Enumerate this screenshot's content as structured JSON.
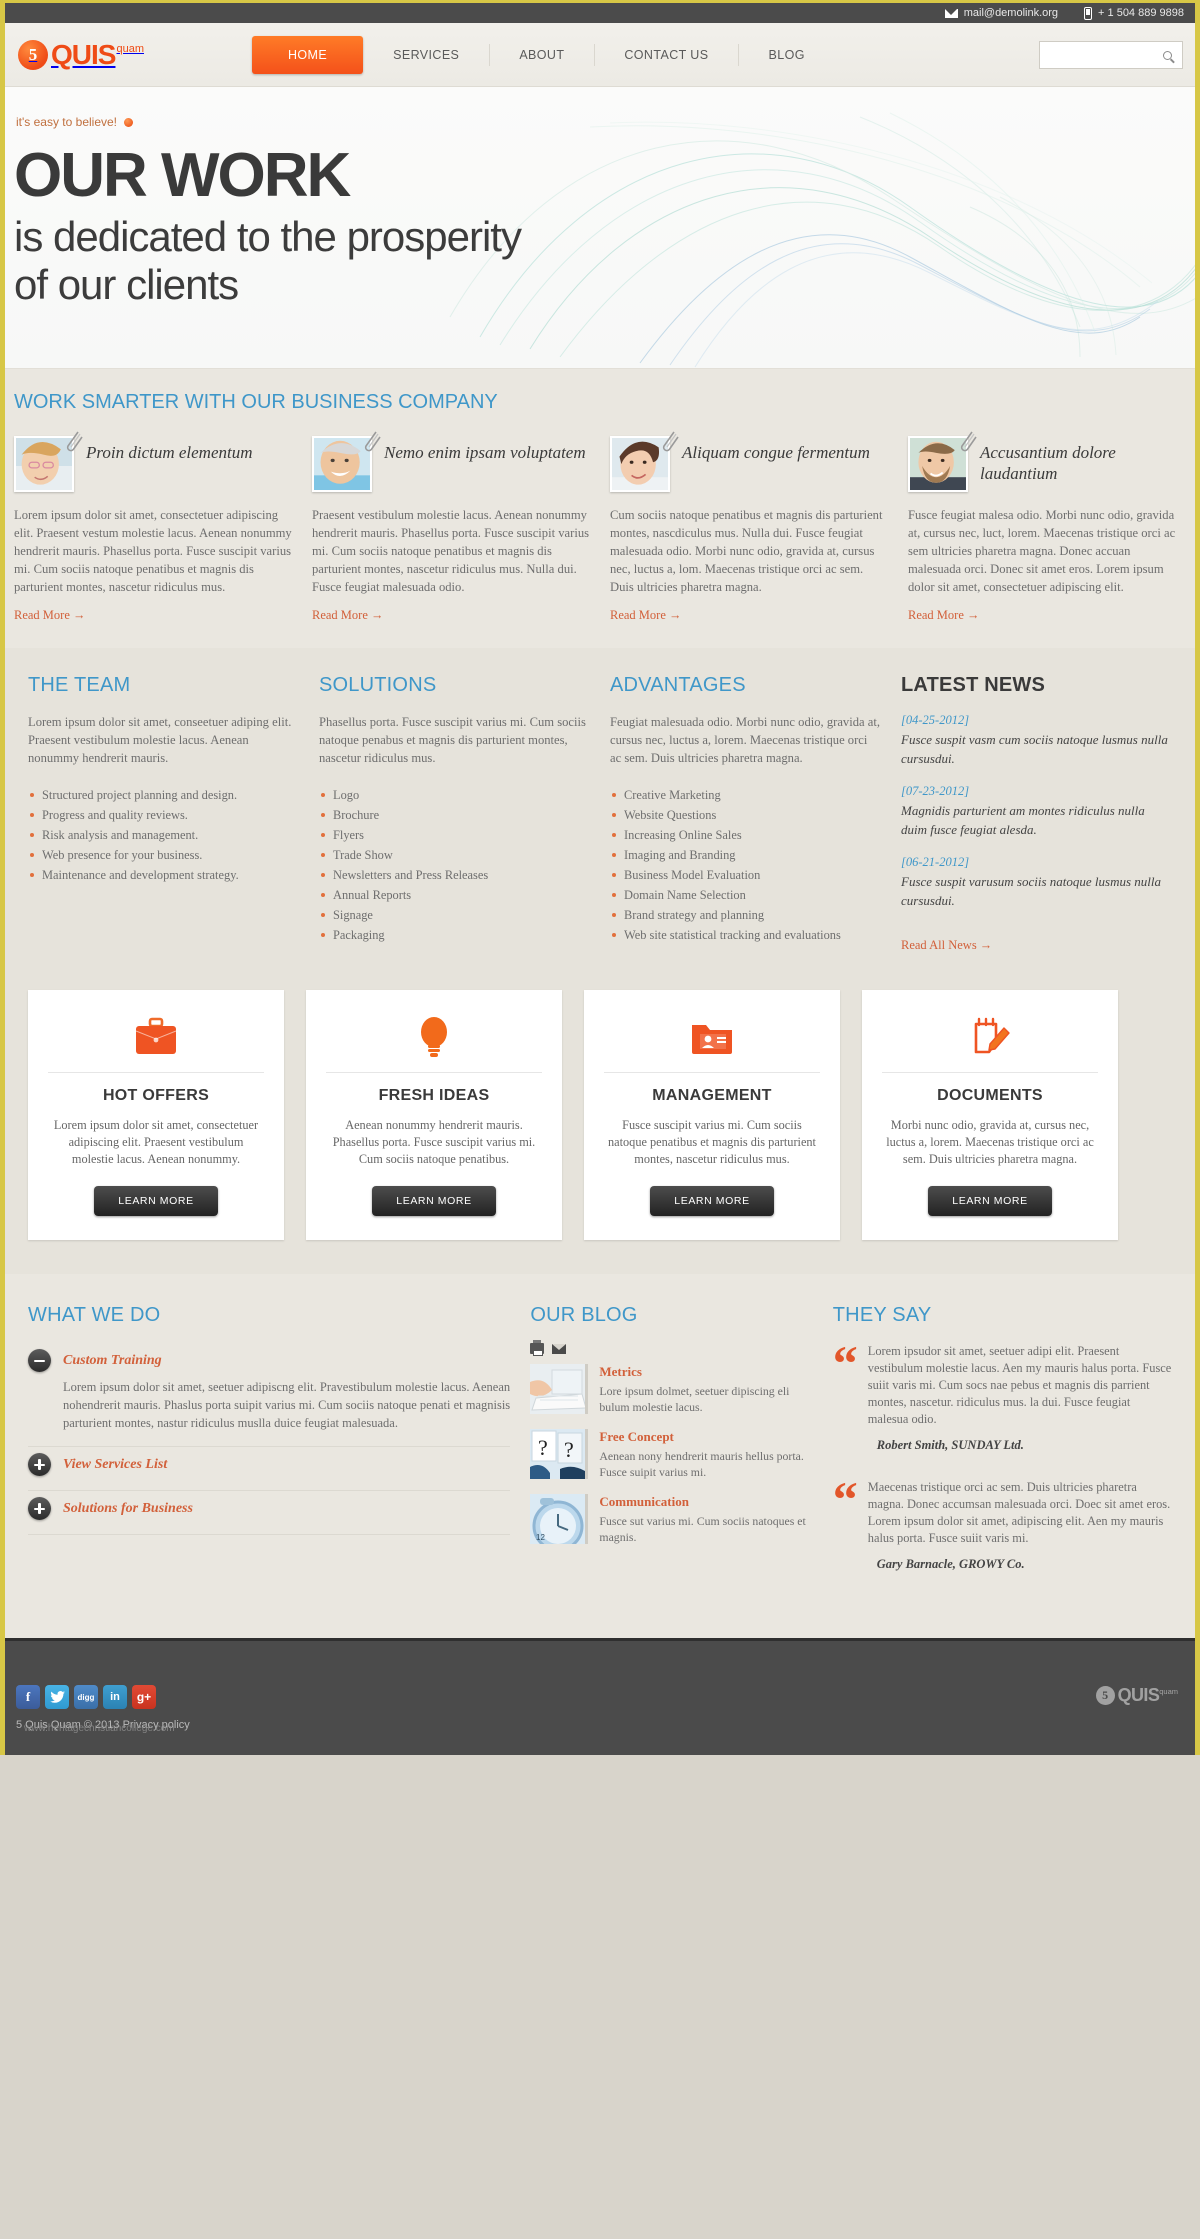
{
  "topbar": {
    "email": "mail@demolink.org",
    "phone": "+ 1 504 889 9898"
  },
  "header": {
    "logo": {
      "mark": "5",
      "name": "QUIS",
      "sup": "quam"
    },
    "nav": [
      {
        "label": "HOME",
        "active": true
      },
      {
        "label": "SERVICES",
        "active": false
      },
      {
        "label": "ABOUT",
        "active": false
      },
      {
        "label": "CONTACT US",
        "active": false
      },
      {
        "label": "BLOG",
        "active": false
      }
    ],
    "search": {
      "value": "",
      "placeholder": ""
    }
  },
  "hero": {
    "tagline": "it's easy to believe!",
    "title": "OUR WORK",
    "subtitle_line1": "is dedicated to the prosperity",
    "subtitle_line2": "of our clients",
    "prev": "‹",
    "next": "›"
  },
  "work_smarter": {
    "title": "WORK SMARTER WITH OUR BUSINESS COMPANY",
    "read_more": "Read More →",
    "cards": [
      {
        "title": "Proin dictum elementum",
        "text": "Lorem ipsum dolor sit amet, consectetuer adipiscing elit. Praesent vestum molestie lacus. Aenean nonummy hendrerit mauris. Phasellus porta. Fusce suscipit varius mi. Cum sociis natoque penatibus et magnis dis parturient montes, nascetur ridiculus mus."
      },
      {
        "title": "Nemo enim ipsam voluptatem",
        "text": "Praesent vestibulum molestie lacus. Aenean nonummy hendrerit mauris. Phasellus porta. Fusce suscipit varius mi. Cum sociis natoque penatibus et magnis dis parturient montes, nascetur ridiculus mus. Nulla dui. Fusce feugiat malesuada odio."
      },
      {
        "title": "Aliquam congue fermentum",
        "text": "Cum sociis natoque penatibus et magnis dis parturient montes, nascdiculus mus. Nulla dui. Fusce feugiat malesuada odio. Morbi nunc odio, gravida at, cursus nec, luctus a, lom. Maecenas tristique orci ac sem. Duis ultricies pharetra magna."
      },
      {
        "title": "Accusantium dolore laudantium",
        "text": "Fusce feugiat malesa odio. Morbi nunc odio, gravida at, cursus nec, luct, lorem. Maecenas tristique orci ac sem ultricies pharetra magna. Donec accuan malesuada orci. Donec sit amet eros. Lorem ipsum dolor sit amet, consectetuer adipiscing elit."
      }
    ]
  },
  "columns": {
    "team": {
      "title": "THE TEAM",
      "text": "Lorem ipsum dolor sit amet, conseetuer adiping elit. Praesent vestibulum molestie lacus. Aenean nonummy hendrerit mauris.",
      "items": [
        "Structured project planning and design.",
        "Progress and quality reviews.",
        "Risk analysis and management.",
        "Web presence for your business.",
        "Maintenance and development strategy."
      ]
    },
    "solutions": {
      "title": "SOLUTIONS",
      "text": "Phasellus porta. Fusce suscipit varius mi. Cum sociis natoque penabus et magnis dis parturient montes, nascetur ridiculus mus.",
      "items": [
        "Logo",
        "Brochure",
        "Flyers",
        "Trade Show",
        "Newsletters and Press Releases",
        "Annual Reports",
        "Signage",
        "Packaging"
      ]
    },
    "advantages": {
      "title": "ADVANTAGES",
      "text": "Feugiat malesuada odio. Morbi nunc odio, gravida at, cursus nec, luctus a, lorem. Maecenas tristique orci ac sem. Duis ultricies pharetra magna.",
      "items": [
        "Creative Marketing",
        "Website Questions",
        "Increasing Online Sales",
        "Imaging and Branding",
        "Business Model Evaluation",
        "Domain Name Selection",
        "Brand strategy and planning",
        "Web site statistical tracking and evaluations"
      ]
    },
    "news": {
      "title": "LATEST NEWS",
      "read_all": "Read All News →",
      "items": [
        {
          "date": "[04-25-2012]",
          "text": "Fusce suspit vasm cum sociis natoque lusmus nulla cursusdui."
        },
        {
          "date": "[07-23-2012]",
          "text": "Magnidis parturient am montes ridiculus nulla duim fusce feugiat alesda."
        },
        {
          "date": "[06-21-2012]",
          "text": "Fusce suspit varusum sociis natoque lusmus nulla cursusdui."
        }
      ]
    }
  },
  "boxes": {
    "button_label": "LEARN MORE",
    "items": [
      {
        "icon": "briefcase-icon",
        "title": "HOT OFFERS",
        "text": "Lorem ipsum dolor sit amet, consectetuer adipiscing elit. Praesent vestibulum molestie lacus. Aenean nonummy."
      },
      {
        "icon": "lightbulb-icon",
        "title": "FRESH IDEAS",
        "text": "Aenean nonummy hendrerit mauris. Phasellus porta. Fusce suscipit varius mi. Cum sociis natoque penatibus."
      },
      {
        "icon": "contact-card-icon",
        "title": "MANAGEMENT",
        "text": "Fusce suscipit varius mi. Cum sociis natoque penatibus et magnis dis parturient montes, nascetur ridiculus mus."
      },
      {
        "icon": "notepad-pencil-icon",
        "title": "DOCUMENTS",
        "text": "Morbi nunc odio, gravida at, cursus nec, luctus a, lorem. Maecenas tristique orci ac sem. Duis ultricies pharetra magna."
      }
    ]
  },
  "what_we_do": {
    "title": "WHAT WE DO",
    "items": [
      {
        "title": "Custom Training",
        "open": true,
        "body": "Lorem ipsum dolor sit amet, seetuer adipiscng elit. Pravestibulum molestie lacus. Aenean nohendrerit mauris. Phaslus porta suipit varius mi. Cum sociis natoque penati et magnisis parturient montes, nastur ridiculus muslla duice feugiat malesuada."
      },
      {
        "title": "View Services List",
        "open": false,
        "body": ""
      },
      {
        "title": "Solutions for Business",
        "open": false,
        "body": ""
      }
    ]
  },
  "our_blog": {
    "title": "OUR BLOG",
    "tools": [
      "print-icon",
      "email-icon"
    ],
    "posts": [
      {
        "title": "Metrics",
        "text": "Lore ipsum dolmet, seetuer dipiscing eli bulum molestie lacus."
      },
      {
        "title": "Free Concept",
        "text": "Aenean nony hendrerit mauris hellus porta. Fusce suipit varius mi."
      },
      {
        "title": "Communication",
        "text": "Fusce sut varius mi. Cum sociis natoques et magnis."
      }
    ]
  },
  "they_say": {
    "title": "THEY SAY",
    "quotes": [
      {
        "text": "Lorem ipsudor sit amet, seetuer adipi elit. Praesent vestibulum molestie lacus. Aen my mauris halus porta. Fusce suiit varis mi. Cum socs nae pebus et magnis dis parrient montes, nascetur. ridiculus mus. la dui. Fusce feugiat malesua odio.",
        "author": "Robert Smith, SUNDAY Ltd."
      },
      {
        "text": "Maecenas tristique orci ac sem. Duis ultricies pharetra magna. Donec accumsan malesuada orci. Doec sit amet eros. Lorem ipsum dolor sit amet, adipiscing elit. Aen my mauris halus porta. Fusce suiit varis mi.",
        "author": "Gary Barnacle, GROWY Co."
      }
    ]
  },
  "footer": {
    "social": [
      {
        "name": "facebook",
        "glyph": "f"
      },
      {
        "name": "twitter",
        "glyph": "ᴠ"
      },
      {
        "name": "digg",
        "glyph": "digg"
      },
      {
        "name": "linkedin",
        "glyph": "in"
      },
      {
        "name": "googleplus",
        "glyph": "g+"
      }
    ],
    "copyright": "5 Quis Quam © 2013",
    "privacy": "Privacy policy",
    "watermark": "www.heritagechristiancollege.com",
    "logo": {
      "mark": "5",
      "name": "QUIS",
      "sup": "quam"
    }
  }
}
